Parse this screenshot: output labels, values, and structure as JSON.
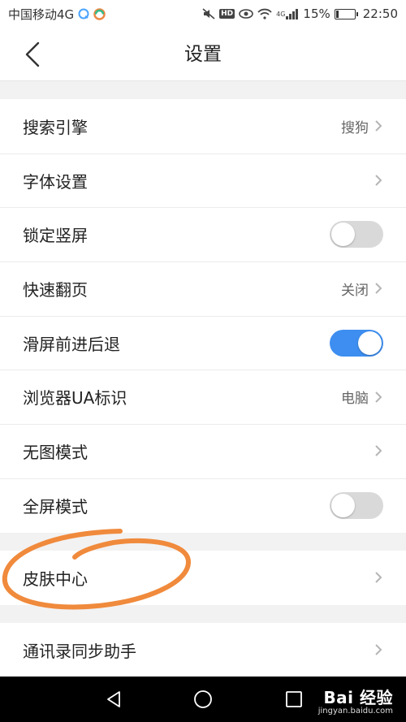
{
  "status_bar": {
    "carrier": "中国移动4G",
    "battery_percent": "15%",
    "battery_level": 0.15,
    "time": "22:50",
    "hd_badge": "HD",
    "network": "4G"
  },
  "header": {
    "title": "设置"
  },
  "settings": [
    {
      "label": "搜索引擎",
      "value": "搜狗",
      "control": "chevron"
    },
    {
      "label": "字体设置",
      "value": "",
      "control": "chevron"
    },
    {
      "label": "锁定竖屏",
      "control": "toggle",
      "on": false
    },
    {
      "label": "快速翻页",
      "value": "关闭",
      "control": "chevron"
    },
    {
      "label": "滑屏前进后退",
      "control": "toggle",
      "on": true
    },
    {
      "label": "浏览器UA标识",
      "value": "电脑",
      "control": "chevron"
    },
    {
      "label": "无图模式",
      "value": "",
      "control": "chevron"
    },
    {
      "label": "全屏模式",
      "control": "toggle",
      "on": false
    }
  ],
  "skin_section": {
    "label": "皮肤中心"
  },
  "contacts_section": {
    "label": "通讯录同步助手"
  },
  "watermark": {
    "logo": "Bai 经验",
    "sub": "jingyan.baidu.com"
  },
  "colors": {
    "accent": "#3d8ef0",
    "annotation": "#f08a3c"
  }
}
